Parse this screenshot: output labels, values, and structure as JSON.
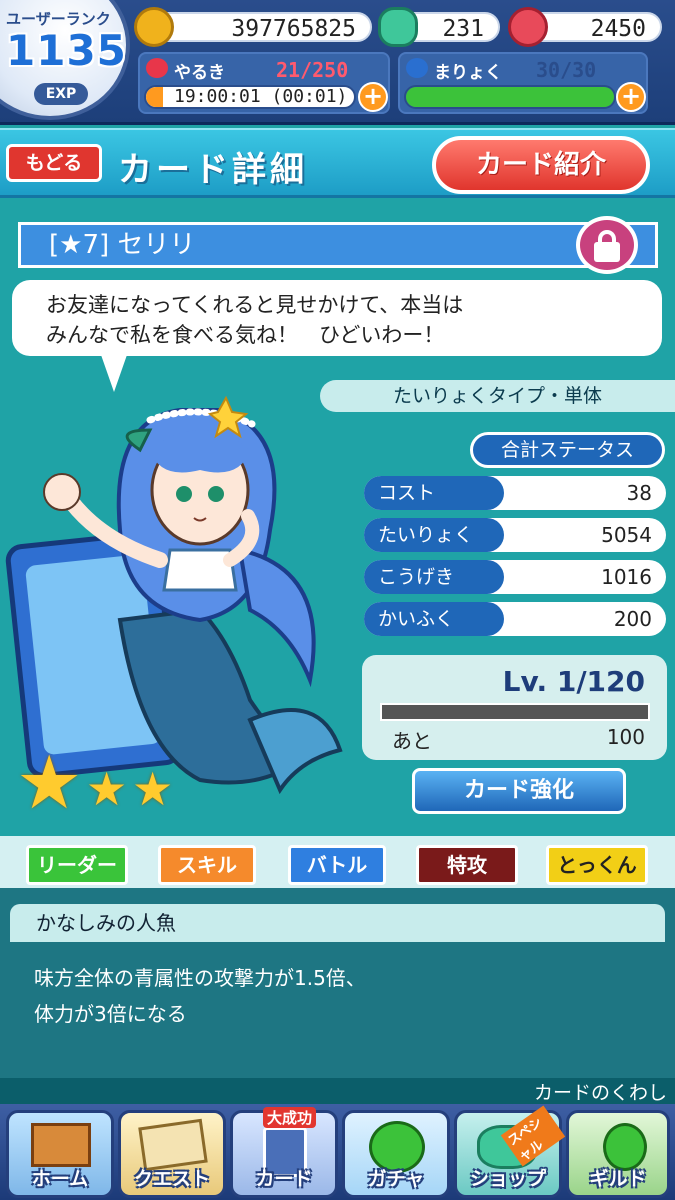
{
  "header": {
    "rank_label": "ユーザーランク",
    "rank": "1135",
    "exp_label": "EXP",
    "coins": "397765825",
    "gems": "231",
    "tickets": "2450",
    "yaruki_label": "やるき",
    "yaruki_value": "21/250",
    "timer": "19:00:01 (00:01)",
    "maryoku_label": "まりょく",
    "maryoku_value": "30/30",
    "plus": "+"
  },
  "titlebar": {
    "back": "もどる",
    "title": "カード詳細",
    "intro": "カード紹介"
  },
  "card": {
    "name": "[★7] セリリ",
    "quote_line1": "お友達になってくれると見せかけて、本当は",
    "quote_line2": "みんなで私を食べる気ね！　ひどいわー！",
    "type": "たいりょくタイプ・単体",
    "status_header": "合計ステータス",
    "stats": [
      {
        "label": "コスト",
        "value": "38"
      },
      {
        "label": "たいりょく",
        "value": "5054"
      },
      {
        "label": "こうげき",
        "value": "1016"
      },
      {
        "label": "かいふく",
        "value": "200"
      }
    ],
    "level": "Lv. 1/120",
    "remain_label": "あと",
    "remain_value": "100",
    "level_progress": 0.0,
    "enhance": "カード強化"
  },
  "tabs": [
    {
      "label": "リーダー",
      "color": "#3ac43a"
    },
    {
      "label": "スキル",
      "color": "#f58a2c"
    },
    {
      "label": "バトル",
      "color": "#2f7fe0"
    },
    {
      "label": "特攻",
      "color": "#7a1a1a"
    },
    {
      "label": "とっくん",
      "color": "#f2cf16"
    }
  ],
  "leader": {
    "name": "かなしみの人魚",
    "desc1": "味方全体の青属性の攻撃力が1.5倍、",
    "desc2": "体力が3倍になる"
  },
  "more": "カードのくわし",
  "nav": [
    {
      "label": "ホーム"
    },
    {
      "label": "クエスト"
    },
    {
      "label": "カード",
      "badge": "大成功"
    },
    {
      "label": "ガチャ"
    },
    {
      "label": "ショップ",
      "badge": "スペシャル"
    },
    {
      "label": "ギルド"
    }
  ]
}
